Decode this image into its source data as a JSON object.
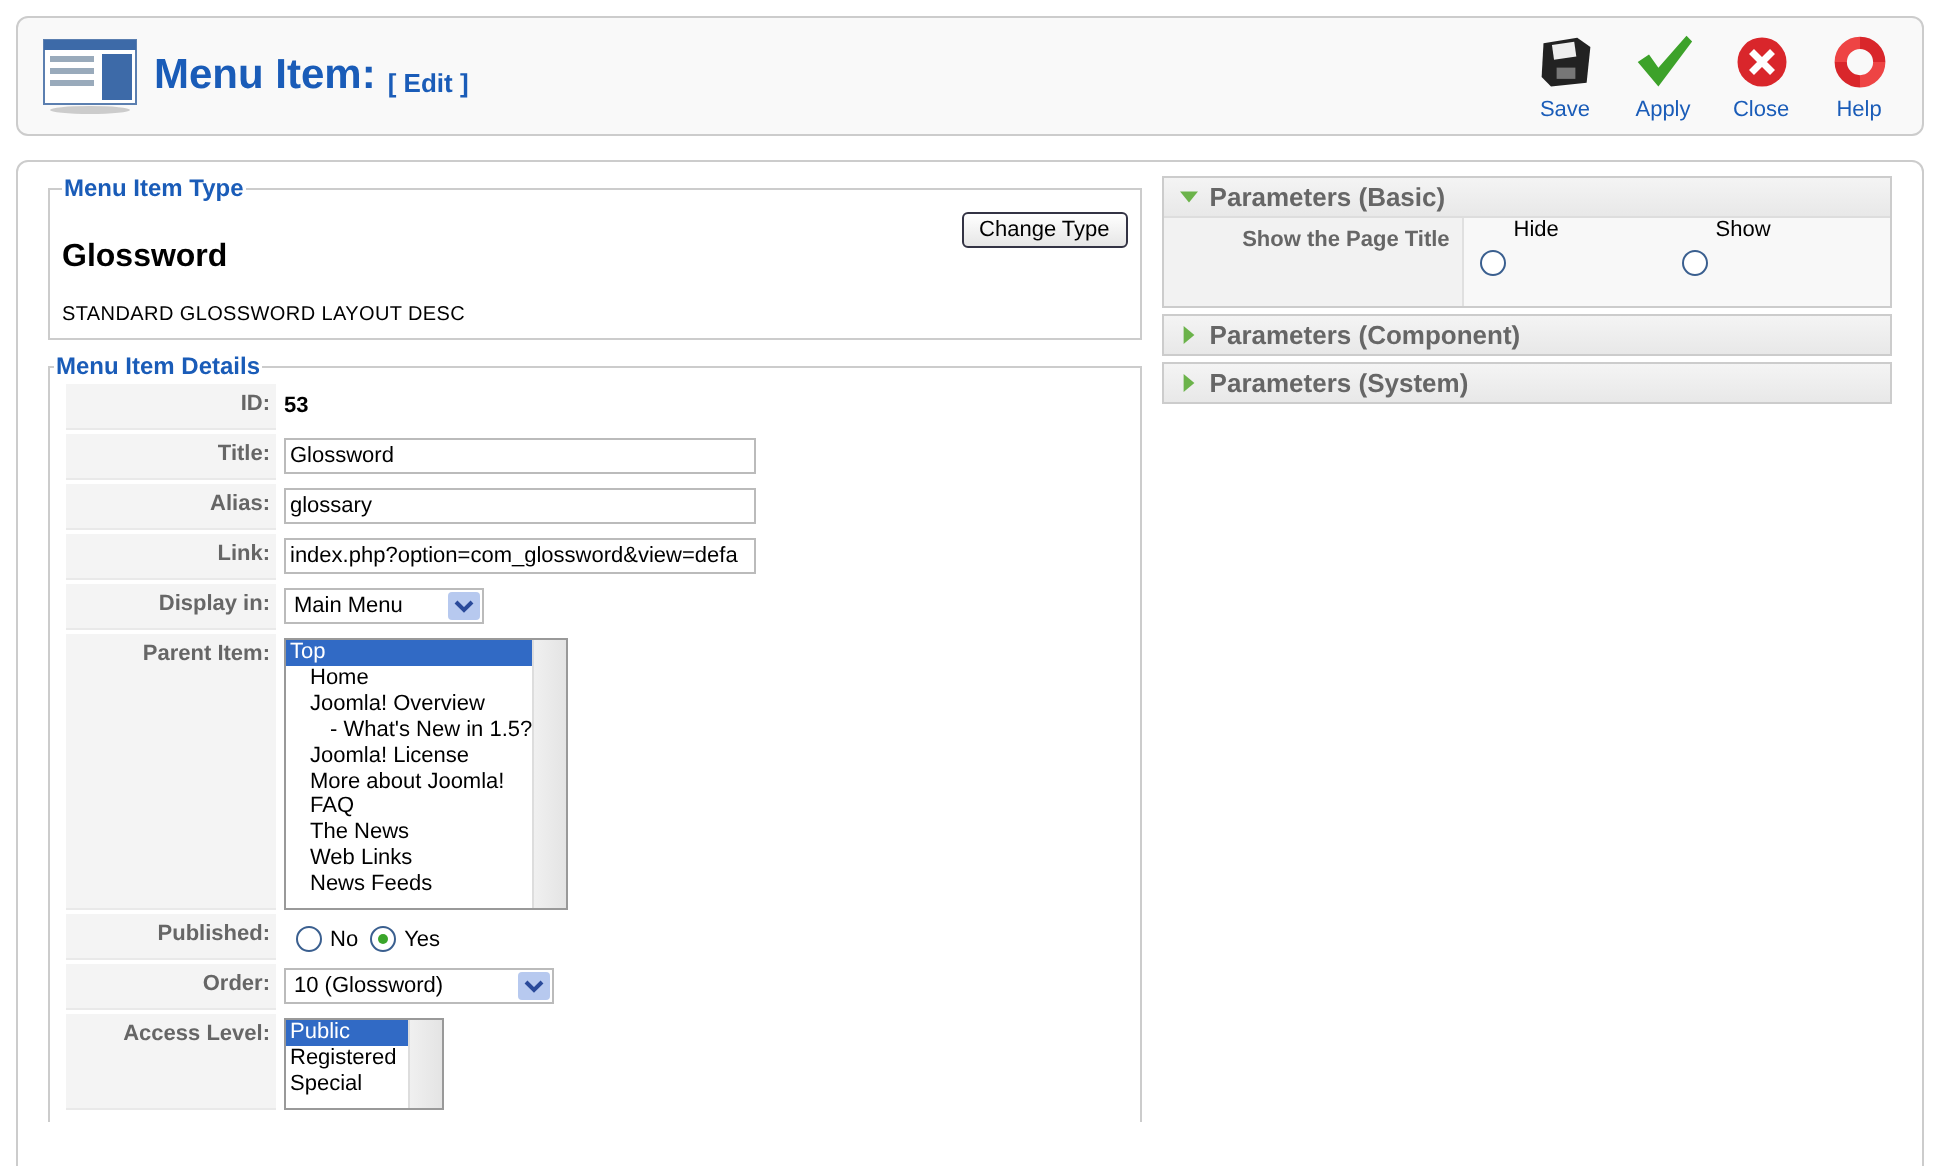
{
  "header": {
    "title": "Menu Item:",
    "subtitle": "[ Edit ]",
    "toolbar": [
      {
        "kind": "save",
        "label": "Save"
      },
      {
        "kind": "apply",
        "label": "Apply"
      },
      {
        "kind": "close",
        "label": "Close"
      },
      {
        "kind": "help",
        "label": "Help"
      }
    ]
  },
  "type_panel": {
    "legend": "Menu Item Type",
    "name": "Glossword",
    "button": "Change Type",
    "description": "STANDARD GLOSSWORD LAYOUT DESC"
  },
  "details": {
    "legend": "Menu Item Details",
    "rows": [
      {
        "kind": "text",
        "label": "ID:",
        "value": "53"
      },
      {
        "kind": "input",
        "label": "Title:",
        "value": "Glossword"
      },
      {
        "kind": "input",
        "label": "Alias:",
        "value": "glossary"
      },
      {
        "kind": "input",
        "label": "Link:",
        "value": "index.php?option=com_glossword&view=defa"
      },
      {
        "kind": "select",
        "label": "Display in:",
        "value": "Main Menu"
      },
      {
        "kind": "tree",
        "label": "Parent Item:",
        "items": [
          {
            "label": "Top",
            "selected": true,
            "children": [
              {
                "label": "Home",
                "selected": false
              },
              {
                "label": "Joomla! Overview",
                "selected": false,
                "children": [
                  {
                    "label": "- What's New in 1.5?",
                    "selected": false
                  }
                ]
              },
              {
                "label": "Joomla! License",
                "selected": false
              },
              {
                "label": "More about Joomla!",
                "selected": false
              },
              {
                "label": "FAQ",
                "selected": false
              },
              {
                "label": "The News",
                "selected": false
              },
              {
                "label": "Web Links",
                "selected": false
              },
              {
                "label": "News Feeds",
                "selected": false
              }
            ]
          }
        ]
      },
      {
        "kind": "radio",
        "label": "Published:",
        "options": [
          {
            "label": "No",
            "selected": false
          },
          {
            "label": "Yes",
            "selected": true
          }
        ]
      },
      {
        "kind": "select",
        "label": "Order:",
        "value": "10 (Glossword)"
      },
      {
        "kind": "list",
        "label": "Access Level:",
        "items": [
          {
            "label": "Public",
            "selected": true
          },
          {
            "label": "Registered",
            "selected": false
          },
          {
            "label": "Special",
            "selected": false
          }
        ]
      }
    ]
  },
  "parameters": [
    {
      "title": "Parameters (Basic)",
      "expanded": true,
      "rows": [
        {
          "label": "Show the Page Title",
          "options": [
            {
              "label": "Hide",
              "selected": false
            },
            {
              "label": "Show",
              "selected": false
            }
          ]
        }
      ]
    },
    {
      "title": "Parameters (Component)",
      "expanded": false
    },
    {
      "title": "Parameters (System)",
      "expanded": false
    }
  ]
}
